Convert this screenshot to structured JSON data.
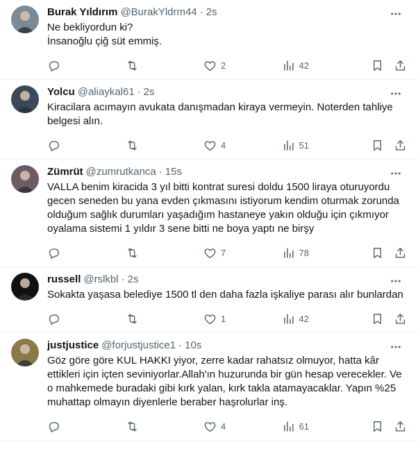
{
  "tweets": [
    {
      "name": "Burak Yıldırım",
      "handle": "@BurakYldrm44",
      "time": "2s",
      "text": "Ne bekliyordun ki?\nİnsanoğlu çiğ süt emmiş.",
      "replies": "",
      "retweets": "",
      "likes": "2",
      "views": "42",
      "avatar_color": "#7a8a96"
    },
    {
      "name": "Yolcu",
      "handle": "@aliaykal61",
      "time": "2s",
      "text": "Kiracilara acımayın avukata danışmadan kiraya vermeyin. Noterden tahliye belgesi alın.",
      "replies": "",
      "retweets": "",
      "likes": "4",
      "views": "51",
      "avatar_color": "#3b4a5a"
    },
    {
      "name": "Zümrüt",
      "handle": "@zumrutkanca",
      "time": "15s",
      "text": "VALLA benim kiracida 3 yıl bitti kontrat suresi doldu 1500 liraya oturuyordu gecen seneden bu yana evden çıkmasını istiyorum kendim oturmak zorunda olduğum sağlık durumları yaşadığım hastaneye yakın olduğu için çıkmıyor oyalama sistemi 1 yıldır 3 sene bitti ne boya yaptı ne birşy",
      "replies": "",
      "retweets": "",
      "likes": "7",
      "views": "78",
      "avatar_color": "#6e5a66"
    },
    {
      "name": "russell",
      "handle": "@rslkbl",
      "time": "2s",
      "text": "Sokakta yaşasa belediye 1500 tl den daha fazla işkaliye parası alır bunlardan",
      "replies": "",
      "retweets": "",
      "likes": "1",
      "views": "42",
      "avatar_color": "#111111"
    },
    {
      "name": "justjustice",
      "handle": "@forjustjustice1",
      "time": "10s",
      "text": "Göz göre göre KUL HAKKI yiyor, zerre kadar rahatsız olmuyor, hatta kâr ettikleri için içten seviniyorlar.Allah'ın huzurunda bir gün hesap verecekler. Ve o mahkemede buradaki gibi kırk yalan, kırk takla atamayacaklar. Yapın %25 muhattap olmayın diyenlerle beraber haşrolurlar inş.",
      "replies": "",
      "retweets": "",
      "likes": "4",
      "views": "61",
      "avatar_color": "#8a7a4a"
    }
  ],
  "icons": {
    "more": "more-horizontal-icon",
    "reply": "reply-icon",
    "retweet": "retweet-icon",
    "like": "heart-icon",
    "views": "views-icon",
    "bookmark": "bookmark-icon",
    "share": "share-icon"
  },
  "colors": {
    "text": "#0f1419",
    "secondary": "#536471",
    "border": "#eff3f4"
  }
}
